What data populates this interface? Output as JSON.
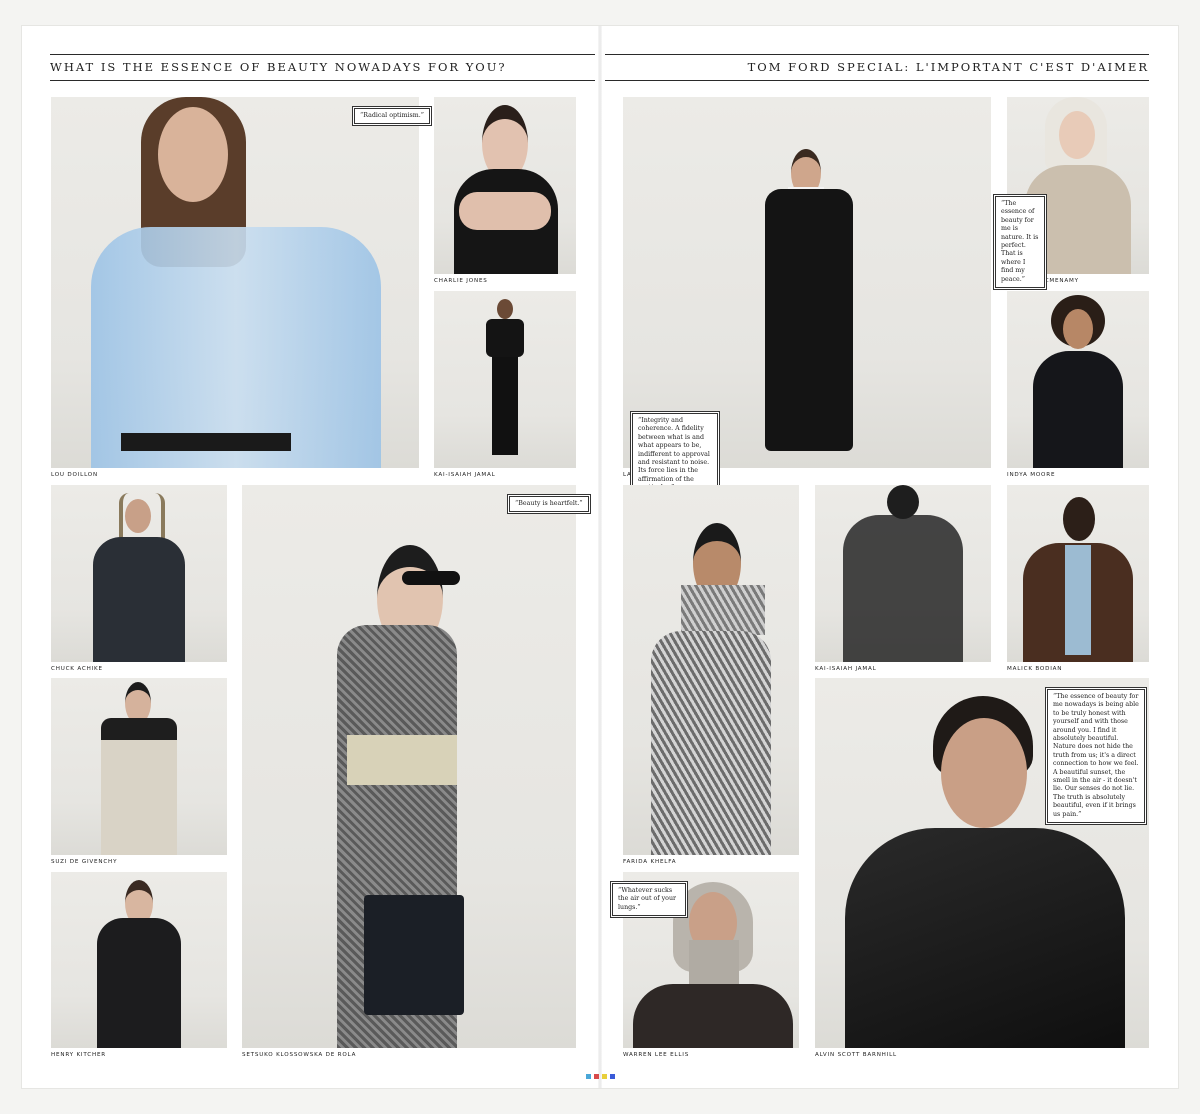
{
  "header": {
    "left_title": "WHAT IS THE ESSENCE OF BEAUTY NOWADAYS FOR YOU?",
    "right_title": "TOM FORD SPECIAL: L'IMPORTANT C'EST D'AIMER"
  },
  "captions": {
    "lou": "LOU DOILLON",
    "charlie": "CHARLIE JONES",
    "kai1": "KAI-ISAIAH JAMAL",
    "laura": "LAURA PONTE",
    "kristen": "KRISTEN MCMENAMY",
    "indya": "INDYA MOORE",
    "chuck": "CHUCK ACHIKE",
    "setsuko": "SETSUKO KLOSSOWSKA DE ROLA",
    "farida": "FARIDA KHELFA",
    "kai2": "KAI-ISAIAH JAMAL",
    "malick": "MALICK BODIAN",
    "suzi": "SUZI DE GIVENCHY",
    "henry": "HENRY KITCHER",
    "warren": "WARREN LEE ELLIS",
    "alvin": "ALVIN SCOTT BARNHILL"
  },
  "quotes": {
    "lou": "“Radical optimism.”",
    "laura": "“Integrity and coherence. A fidelity between what is and what appears to be, indifferent to approval and resistant to noise. Its force lies in the affirmation of the particular.”",
    "kristen": "“The essence of beauty for me is nature. It is perfect. That is where I find my peace.”",
    "setsuko": "“Beauty is heartfelt.”",
    "warren": "“Whatever sucks the air out of your lungs.”",
    "alvin": "“The essence of beauty for me nowadays is being able to be truly honest with yourself and with those around you. I find it absolutely beautiful. Nature does not hide the truth from us; it's a direct connection to how we feel. A beautiful sunset, the smell in the air - it doesn't lie. Our senses do not lie. The truth is absolutely beautiful, even if it brings us pain.”"
  }
}
